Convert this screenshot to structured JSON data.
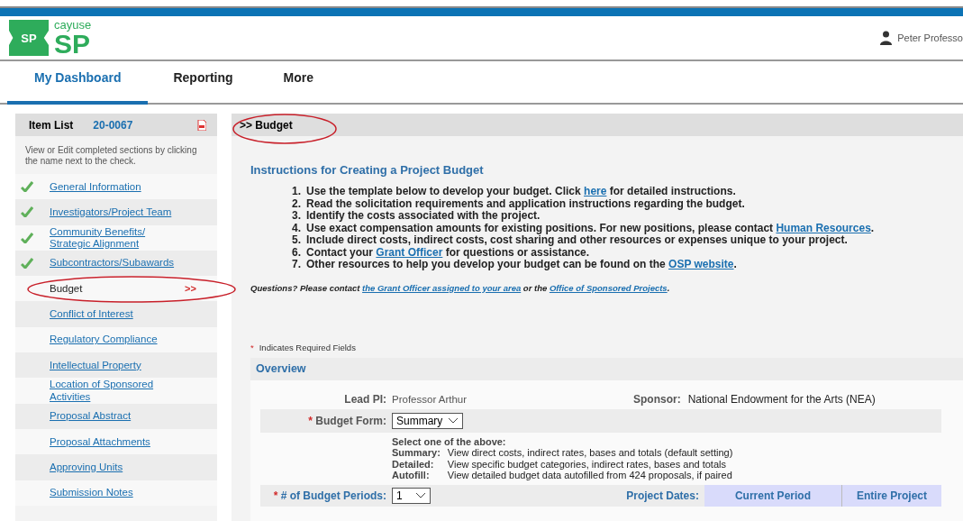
{
  "logo": {
    "badge": "SP",
    "brand_top": "cayuse",
    "brand_main": "SP"
  },
  "user": {
    "name": "Peter Professo"
  },
  "nav": [
    {
      "label": "My Dashboard",
      "selected": true
    },
    {
      "label": "Reporting",
      "selected": false
    },
    {
      "label": "More",
      "selected": false
    }
  ],
  "sidebar": {
    "title": "Item List",
    "number": "20-0067",
    "hint": "View or Edit completed sections by clicking the name next to the check.",
    "items": [
      {
        "label": "General Information",
        "done": true,
        "selected": false
      },
      {
        "label": "Investigators/Project Team",
        "done": true,
        "selected": false
      },
      {
        "label": "Community Benefits/ Strategic Alignment",
        "done": true,
        "selected": false
      },
      {
        "label": "Subcontractors/Subawards",
        "done": true,
        "selected": false
      },
      {
        "label": "Budget",
        "done": false,
        "selected": true,
        "marker": ">>"
      },
      {
        "label": "Conflict of Interest",
        "done": false,
        "selected": false
      },
      {
        "label": "Regulatory Compliance",
        "done": false,
        "selected": false
      },
      {
        "label": "Intellectual Property",
        "done": false,
        "selected": false
      },
      {
        "label": "Location of Sponsored Activities",
        "done": false,
        "selected": false
      },
      {
        "label": "Proposal Abstract",
        "done": false,
        "selected": false
      },
      {
        "label": "Proposal Attachments",
        "done": false,
        "selected": false
      },
      {
        "label": "Approving Units",
        "done": false,
        "selected": false
      },
      {
        "label": "Submission Notes",
        "done": false,
        "selected": false
      }
    ]
  },
  "section_title": ">> Budget",
  "instructions": {
    "title": "Instructions for Creating a Project Budget",
    "steps": [
      {
        "number": "1.",
        "parts": [
          {
            "kind": "text",
            "text": "Use the template below to develop your budget. Click "
          },
          {
            "kind": "link",
            "text": "here"
          },
          {
            "kind": "text",
            "text": " for detailed instructions."
          }
        ]
      },
      {
        "number": "2.",
        "parts": [
          {
            "kind": "text",
            "text": "Read the solicitation requirements and application instructions regarding the budget."
          }
        ]
      },
      {
        "number": "3.",
        "parts": [
          {
            "kind": "text",
            "text": "Identify the costs associated with the project."
          }
        ]
      },
      {
        "number": "4.",
        "parts": [
          {
            "kind": "text",
            "text": "Use exact compensation amounts for existing positions. For new positions, please contact "
          },
          {
            "kind": "link",
            "text": "Human Resources"
          },
          {
            "kind": "text",
            "text": "."
          }
        ]
      },
      {
        "number": "5.",
        "parts": [
          {
            "kind": "text",
            "text": "Include direct costs, indirect costs, cost sharing and other resources or expenses unique to your project."
          }
        ]
      },
      {
        "number": "6.",
        "parts": [
          {
            "kind": "text",
            "text": "Contact your "
          },
          {
            "kind": "link",
            "text": "Grant Officer"
          },
          {
            "kind": "text",
            "text": " for questions or assistance."
          }
        ]
      },
      {
        "number": "7.",
        "parts": [
          {
            "kind": "text",
            "text": "Other resources to help you develop your budget can be found on the "
          },
          {
            "kind": "link",
            "text": "OSP website"
          },
          {
            "kind": "text",
            "text": "."
          }
        ]
      }
    ],
    "questions": [
      {
        "kind": "text",
        "text": "Questions? Please contact "
      },
      {
        "kind": "link",
        "text": "the Grant Officer assigned to your area"
      },
      {
        "kind": "text",
        "text": " or the "
      },
      {
        "kind": "link",
        "text": "Office of Sponsored Projects"
      },
      {
        "kind": "text",
        "text": "."
      }
    ]
  },
  "required_note": {
    "mark": "*",
    "text": "Indicates Required Fields"
  },
  "overview": {
    "title": "Overview",
    "lead_pi_label": "Lead PI:",
    "lead_pi": "Professor Arthur",
    "sponsor_label": "Sponsor:",
    "sponsor": "National Endowment for the Arts (NEA)",
    "budget_form": {
      "mark": "*",
      "label": "Budget Form:",
      "value": "Summary"
    },
    "help_title": "Select one of the above:",
    "options": [
      {
        "name": "Summary:",
        "desc": "View direct costs, indirect rates, bases and totals (default setting)"
      },
      {
        "name": "Detailed:",
        "desc": "View specific budget categories, indirect rates, bases and totals"
      },
      {
        "name": "Autofill:",
        "desc": "View detailed budget data autofilled from 424 proposals, if paired"
      }
    ],
    "periods": {
      "mark": "*",
      "label": "# of Budget Periods:",
      "value": "1"
    },
    "dates_label": "Project Dates:",
    "columns": [
      "Current Period",
      "Entire Project"
    ]
  }
}
